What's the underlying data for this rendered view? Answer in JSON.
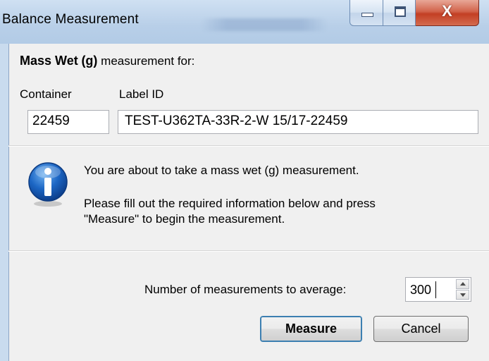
{
  "window": {
    "title": "Balance Measurement",
    "close_glyph": "X",
    "buttons": [
      "minimize-icon",
      "maximize-icon",
      "close-icon"
    ]
  },
  "header": {
    "measure_name": "Mass Wet",
    "measure_unit": "(g)",
    "suffix": "measurement for:"
  },
  "fields": {
    "container_label": "Container",
    "container_value": "22459",
    "label_id_label": "Label ID",
    "label_id_value": "TEST-U362TA-33R-2-W 15/17-22459"
  },
  "info": {
    "icon": "info-icon",
    "line1": "You are about to take a mass wet (g) measurement.",
    "line2": "Please fill out the required information below and press",
    "line3": "\"Measure\" to begin the measurement."
  },
  "averaging": {
    "label": "Number of measurements to average:",
    "value": "300"
  },
  "actions": {
    "measure_label": "Measure",
    "cancel_label": "Cancel"
  },
  "colors": {
    "titlebar": "#b8cfe8",
    "close_button": "#c33f24",
    "client_bg": "#f0f0f0",
    "info_blue": "#1a5fb4"
  }
}
